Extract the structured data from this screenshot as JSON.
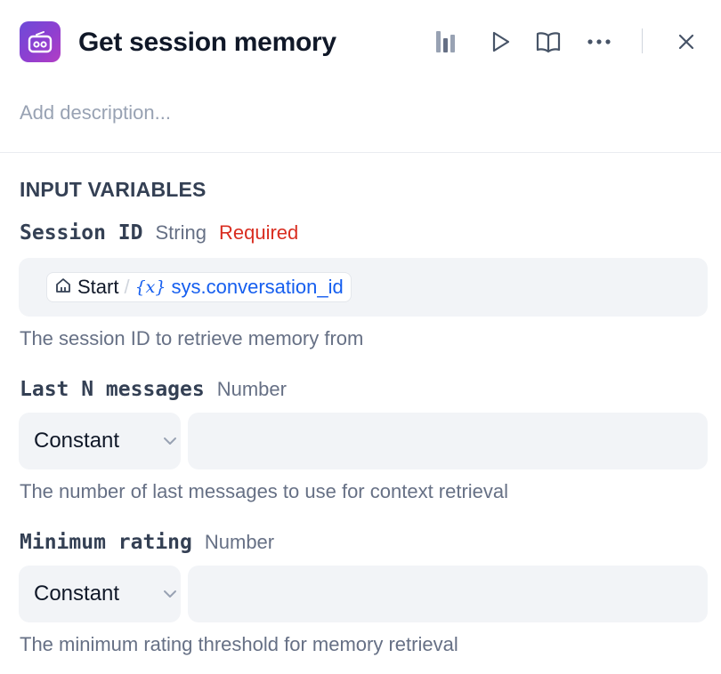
{
  "header": {
    "title": "Get session memory",
    "app_icon": "robot-icon",
    "actions": [
      "chart-icon",
      "play-icon",
      "book-icon",
      "more-icon",
      "close-icon"
    ]
  },
  "description_placeholder": "Add description...",
  "section_title": "INPUT VARIABLES",
  "variables": [
    {
      "name": "Session ID",
      "type": "String",
      "required": "Required",
      "reference": {
        "node": "Start",
        "separator": "/",
        "var_icon": "{x}",
        "var": "sys.conversation_id"
      },
      "help": "The session ID to retrieve memory from"
    },
    {
      "name": "Last N messages",
      "type": "Number",
      "mode": "Constant",
      "value": "",
      "help": "The number of last messages to use for context retrieval"
    },
    {
      "name": "Minimum rating",
      "type": "Number",
      "mode": "Constant",
      "value": "",
      "help": "The minimum rating threshold for memory retrieval"
    }
  ],
  "colors": {
    "accent": "#155eef",
    "required": "#d92d20",
    "input_bg": "#f2f4f7",
    "icon_gradient_start": "#6d4bd8",
    "icon_gradient_end": "#b23ec4"
  }
}
